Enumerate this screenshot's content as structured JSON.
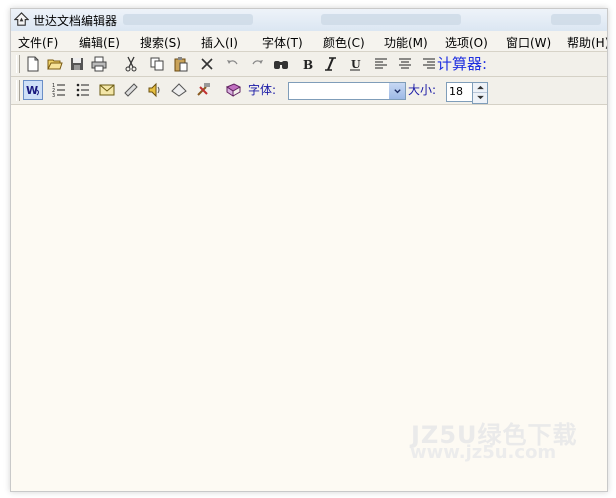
{
  "window": {
    "title": "世达文档编辑器",
    "accent_color": "#2030e0",
    "background_color": "#fdfaf3"
  },
  "menu": [
    {
      "label": "文件(F)",
      "name": "menu-file"
    },
    {
      "label": "编辑(E)",
      "name": "menu-edit"
    },
    {
      "label": "搜索(S)",
      "name": "menu-search"
    },
    {
      "label": "插入(I)",
      "name": "menu-insert"
    },
    {
      "label": "字体(T)",
      "name": "menu-font"
    },
    {
      "label": "颜色(C)",
      "name": "menu-color"
    },
    {
      "label": "功能(M)",
      "name": "menu-function"
    },
    {
      "label": "选项(O)",
      "name": "menu-options"
    },
    {
      "label": "窗口(W)",
      "name": "menu-window"
    },
    {
      "label": "帮助(H)",
      "name": "menu-help"
    }
  ],
  "toolbar1": {
    "icons": [
      "new-file-icon",
      "open-folder-icon",
      "save-icon",
      "print-icon",
      "cut-icon",
      "copy-icon",
      "paste-icon",
      "delete-icon",
      "undo-icon",
      "redo-icon",
      "find-icon",
      "bold-icon",
      "italic-icon",
      "underline-icon",
      "align-left-icon",
      "align-center-icon",
      "align-right-icon"
    ],
    "calculator_label": "计算器:"
  },
  "toolbar2": {
    "icons": [
      "word-wrap-icon",
      "numbered-list-icon",
      "bullet-list-icon",
      "mail-icon",
      "ruler-icon",
      "speaker-icon",
      "eraser-icon",
      "tools-icon",
      "book-icon"
    ],
    "font_label": "字体:",
    "font_value": "",
    "size_label": "大小:",
    "size_value": "18"
  },
  "editor": {
    "content": ""
  },
  "watermark": {
    "line1": "JZ5U绿色下载",
    "line2": "www.jz5u.com"
  }
}
